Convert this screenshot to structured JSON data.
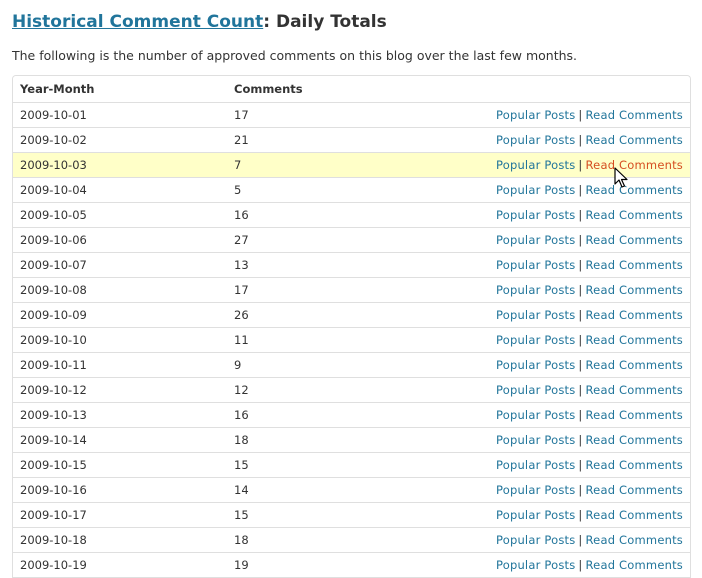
{
  "title": {
    "link_text": "Historical Comment Count",
    "suffix": ": Daily Totals"
  },
  "intro": "The following is the number of approved comments on this blog over the last few months.",
  "table": {
    "headers": {
      "year_month": "Year-Month",
      "comments": "Comments"
    },
    "link_labels": {
      "popular": "Popular Posts",
      "separator": "|",
      "read": "Read Comments"
    },
    "highlighted_row": 2,
    "rows": [
      {
        "date": "2009-10-01",
        "count": "17"
      },
      {
        "date": "2009-10-02",
        "count": "21"
      },
      {
        "date": "2009-10-03",
        "count": "7"
      },
      {
        "date": "2009-10-04",
        "count": "5"
      },
      {
        "date": "2009-10-05",
        "count": "16"
      },
      {
        "date": "2009-10-06",
        "count": "27"
      },
      {
        "date": "2009-10-07",
        "count": "13"
      },
      {
        "date": "2009-10-08",
        "count": "17"
      },
      {
        "date": "2009-10-09",
        "count": "26"
      },
      {
        "date": "2009-10-10",
        "count": "11"
      },
      {
        "date": "2009-10-11",
        "count": "9"
      },
      {
        "date": "2009-10-12",
        "count": "12"
      },
      {
        "date": "2009-10-13",
        "count": "16"
      },
      {
        "date": "2009-10-14",
        "count": "18"
      },
      {
        "date": "2009-10-15",
        "count": "15"
      },
      {
        "date": "2009-10-16",
        "count": "14"
      },
      {
        "date": "2009-10-17",
        "count": "15"
      },
      {
        "date": "2009-10-18",
        "count": "18"
      },
      {
        "date": "2009-10-19",
        "count": "19"
      }
    ]
  },
  "colors": {
    "link": "#21759b",
    "link_hover": "#d54e21",
    "highlight_row": "#ffffc8",
    "border": "#dfdfdf"
  },
  "icons": {
    "cursor": "mouse-pointer-icon"
  }
}
